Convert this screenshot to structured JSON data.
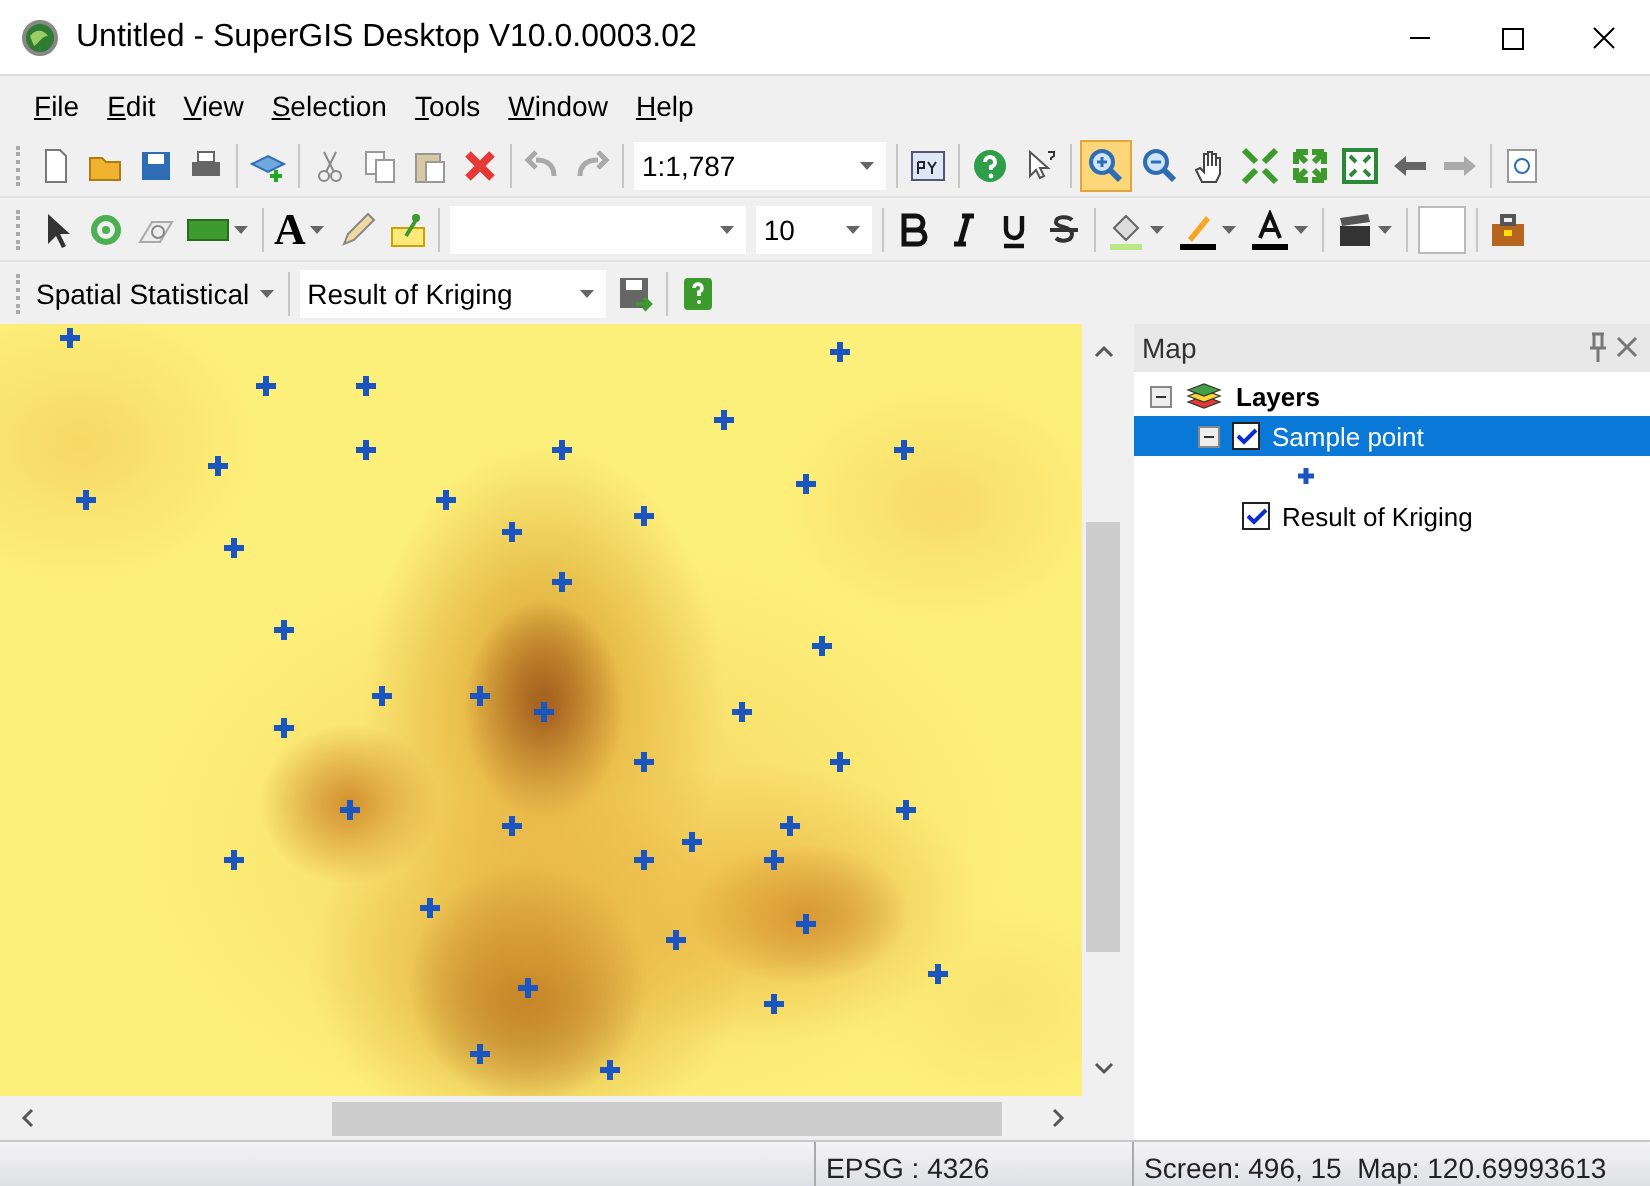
{
  "window": {
    "title": "Untitled - SuperGIS Desktop V10.0.0003.02"
  },
  "menu": [
    "File",
    "Edit",
    "View",
    "Selection",
    "Tools",
    "Window",
    "Help"
  ],
  "toolbar": {
    "text_tool": "A",
    "scale": "1:1,787",
    "font_size": "10",
    "zoom_in_selected": true
  },
  "analysis_bar": {
    "tool": "Spatial Statistical",
    "layer": "Result of Kriging"
  },
  "map_panel": {
    "title": "Map",
    "tree": [
      {
        "label": "Layers",
        "expanded": true,
        "children": [
          {
            "label": "Sample point",
            "checked": true,
            "selected": true,
            "expanded": true
          },
          {
            "label": "Result of Kriging",
            "checked": true,
            "selected": false
          }
        ]
      }
    ]
  },
  "status_bar": {
    "crs": "EPSG : 4326",
    "coords": "Screen: 496, 15  Map: 120.69993613"
  }
}
